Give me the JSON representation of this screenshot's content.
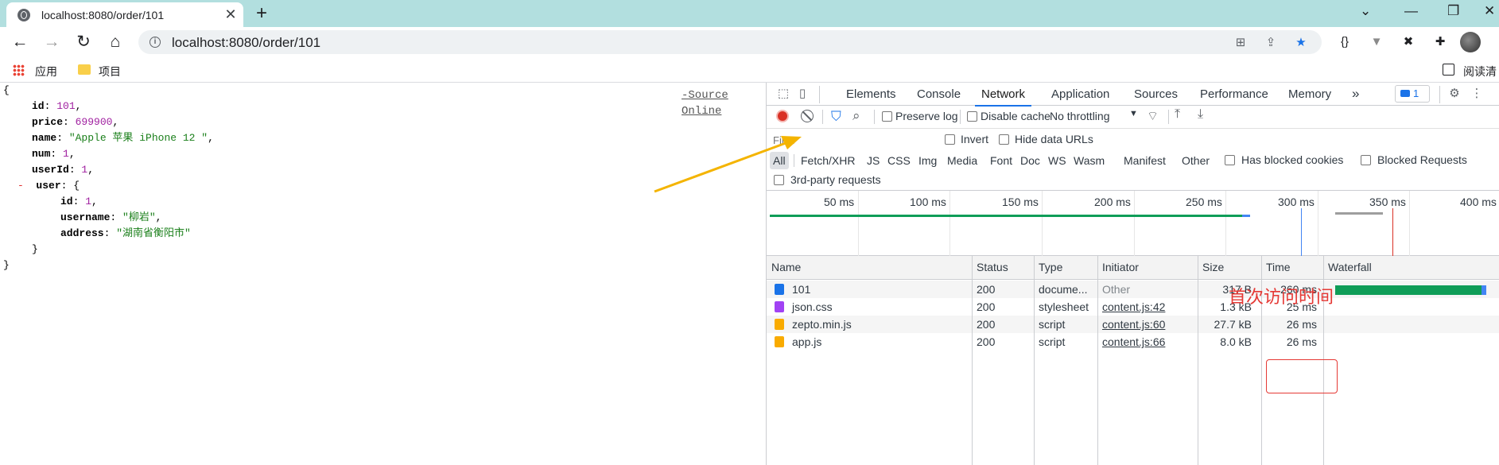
{
  "browser": {
    "tab_title": "localhost:8080/order/101",
    "tab_close": "✕",
    "new_tab": "+",
    "url": "localhost:8080/order/101",
    "window_controls": [
      "⌄",
      "—",
      "❐",
      "✕"
    ]
  },
  "bookmarks": {
    "apps_label": "应用",
    "folder_label": "项目",
    "reading_list_label": "阅读清"
  },
  "json_viewer": {
    "links": [
      "-Source",
      "Online"
    ],
    "open_brace": "{",
    "close_brace": "}",
    "fields": {
      "id_key": "id",
      "id_val": "101",
      "price_key": "price",
      "price_val": "699900",
      "name_key": "name",
      "name_val": "\"Apple 苹果 iPhone 12 \"",
      "num_key": "num",
      "num_val": "1",
      "userId_key": "userId",
      "userId_val": "1",
      "user_toggle": "-",
      "user_key": "user",
      "user_id_key": "id",
      "user_id_val": "1",
      "username_key": "username",
      "username_val": "\"柳岩\"",
      "address_key": "address",
      "address_val": "\"湖南省衡阳市\""
    }
  },
  "devtools": {
    "tabs": [
      "Elements",
      "Console",
      "Network",
      "Application",
      "Sources",
      "Performance",
      "Memory"
    ],
    "active_tab": "Network",
    "more_tabs": "»",
    "issues_count": "1",
    "toolbar": {
      "preserve_log": "Preserve log",
      "disable_cache": "Disable cache",
      "throttling": "No throttling"
    },
    "filter_placeholder": "Filter",
    "invert": "Invert",
    "hide_data_urls": "Hide data URLs",
    "types": [
      "All",
      "Fetch/XHR",
      "JS",
      "CSS",
      "Img",
      "Media",
      "Font",
      "Doc",
      "WS",
      "Wasm",
      "Manifest",
      "Other"
    ],
    "has_blocked_cookies": "Has blocked cookies",
    "blocked_requests": "Blocked Requests",
    "third_party": "3rd-party requests",
    "timeline_labels": [
      "50 ms",
      "100 ms",
      "150 ms",
      "200 ms",
      "250 ms",
      "300 ms",
      "350 ms",
      "400 ms"
    ],
    "annotation": "首次访问时间",
    "columns": [
      "Name",
      "Status",
      "Type",
      "Initiator",
      "Size",
      "Time",
      "Waterfall"
    ],
    "rows": [
      {
        "name": "101",
        "status": "200",
        "type": "docume...",
        "initiator": "Other",
        "size": "317 B",
        "time": "260 ms",
        "icon": "document-icon",
        "icon_color": "#1a73e8"
      },
      {
        "name": "json.css",
        "status": "200",
        "type": "stylesheet",
        "initiator": "content.js:42",
        "size": "1.3 kB",
        "time": "25 ms",
        "icon": "stylesheet-icon",
        "icon_color": "#a142f4"
      },
      {
        "name": "zepto.min.js",
        "status": "200",
        "type": "script",
        "initiator": "content.js:60",
        "size": "27.7 kB",
        "time": "26 ms",
        "icon": "script-icon",
        "icon_color": "#f9ab00"
      },
      {
        "name": "app.js",
        "status": "200",
        "type": "script",
        "initiator": "content.js:66",
        "size": "8.0 kB",
        "time": "26 ms",
        "icon": "script-icon",
        "icon_color": "#f9ab00"
      }
    ]
  },
  "colors": {
    "tabstrip_bg": "#b2dfdf",
    "accent_blue": "#1a73e8",
    "record_red": "#d93025",
    "annotation_red": "#e53935",
    "waterfall_green": "#0f9d58",
    "arrow_orange": "#f4b400"
  }
}
